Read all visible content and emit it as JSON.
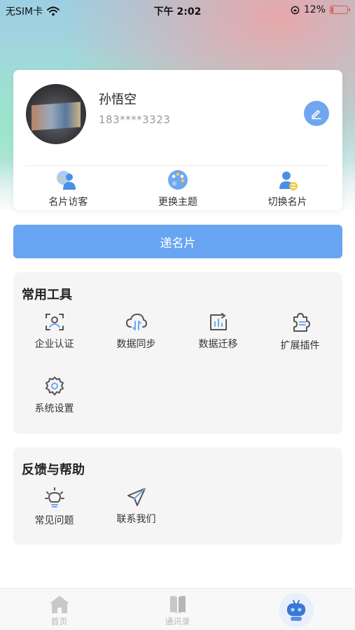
{
  "status_bar": {
    "carrier": "无SIM卡",
    "time": "下午 2:02",
    "battery": "12%"
  },
  "profile": {
    "name": "孙悟空",
    "phone": "183****3323",
    "actions": [
      {
        "label": "名片访客",
        "icon": "visitors-icon"
      },
      {
        "label": "更换主题",
        "icon": "palette-icon"
      },
      {
        "label": "切换名片",
        "icon": "switch-card-icon"
      }
    ]
  },
  "send_card_button": "递名片",
  "tools": {
    "title": "常用工具",
    "items": [
      {
        "label": "企业认证",
        "icon": "verify-icon"
      },
      {
        "label": "数据同步",
        "icon": "cloud-sync-icon"
      },
      {
        "label": "数据迁移",
        "icon": "data-migrate-icon"
      },
      {
        "label": "扩展插件",
        "icon": "plugin-icon"
      },
      {
        "label": "系统设置",
        "icon": "gear-icon"
      }
    ]
  },
  "help": {
    "title": "反馈与帮助",
    "items": [
      {
        "label": "常见问题",
        "icon": "lightbulb-icon"
      },
      {
        "label": "联系我们",
        "icon": "send-icon"
      }
    ]
  },
  "tabbar": {
    "items": [
      {
        "label": "首页",
        "icon": "home-icon"
      },
      {
        "label": "通讯录",
        "icon": "contacts-book-icon"
      },
      {
        "label": "",
        "icon": "ai-assistant-icon"
      }
    ]
  },
  "colors": {
    "accent": "#69a4f3",
    "battery_low": "#e25555",
    "section_bg": "#f5f5f6"
  }
}
